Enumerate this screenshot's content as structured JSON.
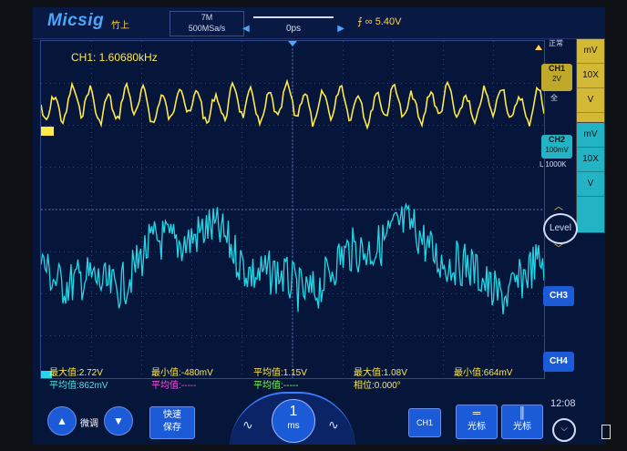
{
  "brand": {
    "logo": "Micsig",
    "subtitle": "竹上"
  },
  "acquisition": {
    "memory": "7M",
    "sample_rate": "500MSa/s"
  },
  "trigger": {
    "position": "0ps",
    "level": "5.40V",
    "edge_icon": "rising-edge-icon"
  },
  "status": {
    "mode": "正常"
  },
  "ch1": {
    "label": "CH1",
    "scale": "2V",
    "coupling": "全",
    "stack": [
      "mV",
      "10X",
      "V"
    ],
    "frequency": "CH1: 1.60680kHz"
  },
  "ch2": {
    "label": "CH2",
    "scale": "100mV",
    "probe": "L 1000K",
    "stack": [
      "mV",
      "10X",
      "V"
    ]
  },
  "level_btn": "Level",
  "ch3_btn": "CH3",
  "ch4_btn": "CH4",
  "measurements": {
    "row1": [
      {
        "label": "最大值:2.72V",
        "color": "#ffe84a"
      },
      {
        "label": "最小值:-480mV",
        "color": "#ffe84a"
      },
      {
        "label": "平均值:1.15V",
        "color": "#ffe84a"
      },
      {
        "label": "最大值:1.08V",
        "color": "#ffe84a"
      },
      {
        "label": "最小值:664mV",
        "color": "#ffe84a"
      }
    ],
    "row2": [
      {
        "label": "平均值:862mV",
        "color": "#4de0e8"
      },
      {
        "label": "平均值:-----",
        "color": "#ff4de6"
      },
      {
        "label": "平均值:-----",
        "color": "#7cff4d"
      },
      {
        "label": "相位:0.000°",
        "color": "#ffe84a"
      }
    ]
  },
  "bottom": {
    "fine": "微调",
    "quick_save": "快速\n保存",
    "timebase": "1",
    "timebase_unit": "ms",
    "ch1_btn": "CH1",
    "cursor1": "光标",
    "cursor2": "光标",
    "time": "12:08"
  },
  "colors": {
    "ch1": "#ffe84a",
    "ch2": "#22d8e8",
    "grid": "#5a6ea8"
  }
}
